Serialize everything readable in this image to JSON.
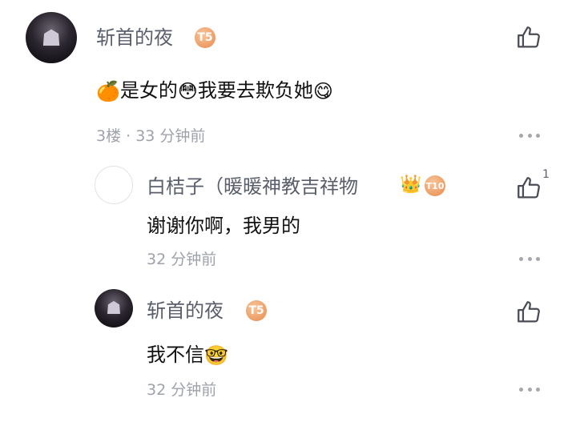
{
  "comments": [
    {
      "name": "斩首的夜",
      "badge": "T5",
      "text_parts": [
        "🍊",
        "是女的",
        "😳",
        "我要去欺负她",
        "😋"
      ],
      "meta": "3楼 · 33 分钟前"
    }
  ],
  "replies": [
    {
      "name": "白桔子（暖暖神教吉祥物",
      "crown": "👑",
      "badge": "T10",
      "text": "谢谢你啊，我男的",
      "meta": "32 分钟前",
      "like_count": "1"
    },
    {
      "name": "斩首的夜",
      "badge": "T5",
      "text": "我不信",
      "emoji": "🤓",
      "meta": "32 分钟前"
    }
  ],
  "icons": {
    "like": "thumbs-up-icon",
    "more": "more-dots-icon"
  },
  "colors": {
    "name": "#5a5f6b",
    "meta": "#9ea2aa",
    "badge": "#e98a4b"
  }
}
